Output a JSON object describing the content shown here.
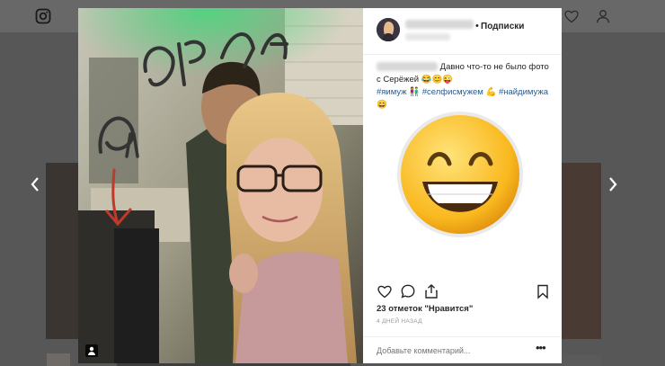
{
  "header": {
    "follow_label": "Подписки"
  },
  "post": {
    "caption_text": "Давно что-то не было фото с Серёжей",
    "caption_emojis": "😂😊😜",
    "hashtags": [
      "#яимуж",
      "#селфисмужем",
      "#найдимужа"
    ],
    "handwriting": [
      "Серёжа"
    ],
    "likes_label": "23 отметок \"Нравится\"",
    "time_label": "4 ДНЕЙ НАЗАД"
  },
  "comment": {
    "placeholder": "Добавьте комментарий..."
  },
  "icons": {
    "app": "instagram-icon",
    "top_right": [
      "compass-icon",
      "heart-icon",
      "profile-icon"
    ],
    "actions": [
      "heart-icon",
      "comment-icon",
      "share-icon",
      "bookmark-icon"
    ]
  }
}
